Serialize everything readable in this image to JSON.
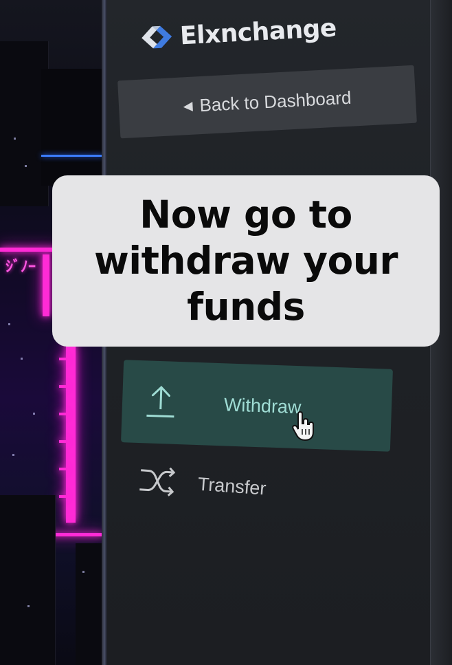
{
  "app": {
    "brand_name": "Elxnchange"
  },
  "sidebar": {
    "back_button_label": "Back to Dashboard",
    "items": [
      {
        "label": "Withdraw",
        "icon": "upload-icon",
        "active": true
      },
      {
        "label": "Transfer",
        "icon": "shuffle-icon",
        "active": false
      }
    ]
  },
  "caption": {
    "text": "Now go to withdraw your funds"
  },
  "colors": {
    "sidebar_bg": "#1f2226",
    "active_item_bg": "#284a47",
    "active_item_text": "#9fdcd4",
    "caption_bg": "#e5e5e7",
    "neon_pink": "#ff2bd6"
  }
}
